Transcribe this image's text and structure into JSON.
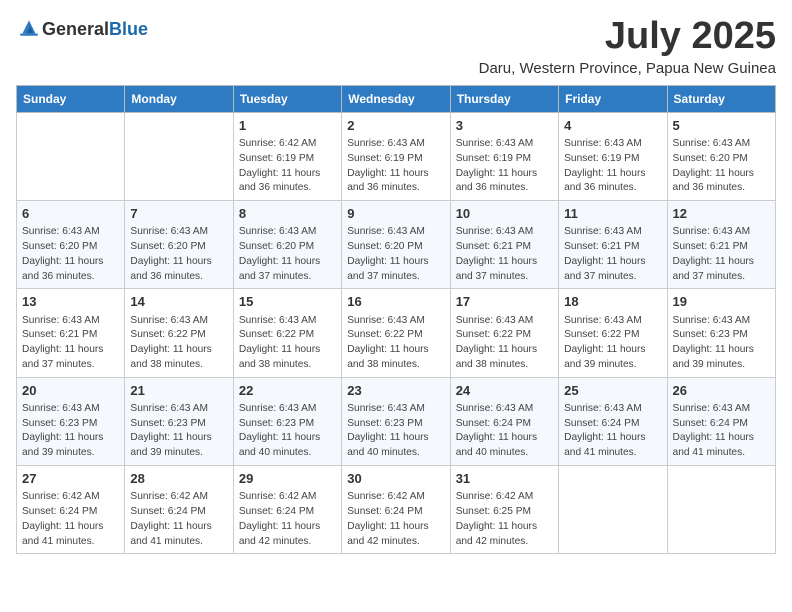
{
  "header": {
    "logo_general": "General",
    "logo_blue": "Blue",
    "month_title": "July 2025",
    "location": "Daru, Western Province, Papua New Guinea"
  },
  "weekdays": [
    "Sunday",
    "Monday",
    "Tuesday",
    "Wednesday",
    "Thursday",
    "Friday",
    "Saturday"
  ],
  "weeks": [
    [
      {
        "day": "",
        "info": ""
      },
      {
        "day": "",
        "info": ""
      },
      {
        "day": "1",
        "info": "Sunrise: 6:42 AM\nSunset: 6:19 PM\nDaylight: 11 hours and 36 minutes."
      },
      {
        "day": "2",
        "info": "Sunrise: 6:43 AM\nSunset: 6:19 PM\nDaylight: 11 hours and 36 minutes."
      },
      {
        "day": "3",
        "info": "Sunrise: 6:43 AM\nSunset: 6:19 PM\nDaylight: 11 hours and 36 minutes."
      },
      {
        "day": "4",
        "info": "Sunrise: 6:43 AM\nSunset: 6:19 PM\nDaylight: 11 hours and 36 minutes."
      },
      {
        "day": "5",
        "info": "Sunrise: 6:43 AM\nSunset: 6:20 PM\nDaylight: 11 hours and 36 minutes."
      }
    ],
    [
      {
        "day": "6",
        "info": "Sunrise: 6:43 AM\nSunset: 6:20 PM\nDaylight: 11 hours and 36 minutes."
      },
      {
        "day": "7",
        "info": "Sunrise: 6:43 AM\nSunset: 6:20 PM\nDaylight: 11 hours and 36 minutes."
      },
      {
        "day": "8",
        "info": "Sunrise: 6:43 AM\nSunset: 6:20 PM\nDaylight: 11 hours and 37 minutes."
      },
      {
        "day": "9",
        "info": "Sunrise: 6:43 AM\nSunset: 6:20 PM\nDaylight: 11 hours and 37 minutes."
      },
      {
        "day": "10",
        "info": "Sunrise: 6:43 AM\nSunset: 6:21 PM\nDaylight: 11 hours and 37 minutes."
      },
      {
        "day": "11",
        "info": "Sunrise: 6:43 AM\nSunset: 6:21 PM\nDaylight: 11 hours and 37 minutes."
      },
      {
        "day": "12",
        "info": "Sunrise: 6:43 AM\nSunset: 6:21 PM\nDaylight: 11 hours and 37 minutes."
      }
    ],
    [
      {
        "day": "13",
        "info": "Sunrise: 6:43 AM\nSunset: 6:21 PM\nDaylight: 11 hours and 37 minutes."
      },
      {
        "day": "14",
        "info": "Sunrise: 6:43 AM\nSunset: 6:22 PM\nDaylight: 11 hours and 38 minutes."
      },
      {
        "day": "15",
        "info": "Sunrise: 6:43 AM\nSunset: 6:22 PM\nDaylight: 11 hours and 38 minutes."
      },
      {
        "day": "16",
        "info": "Sunrise: 6:43 AM\nSunset: 6:22 PM\nDaylight: 11 hours and 38 minutes."
      },
      {
        "day": "17",
        "info": "Sunrise: 6:43 AM\nSunset: 6:22 PM\nDaylight: 11 hours and 38 minutes."
      },
      {
        "day": "18",
        "info": "Sunrise: 6:43 AM\nSunset: 6:22 PM\nDaylight: 11 hours and 39 minutes."
      },
      {
        "day": "19",
        "info": "Sunrise: 6:43 AM\nSunset: 6:23 PM\nDaylight: 11 hours and 39 minutes."
      }
    ],
    [
      {
        "day": "20",
        "info": "Sunrise: 6:43 AM\nSunset: 6:23 PM\nDaylight: 11 hours and 39 minutes."
      },
      {
        "day": "21",
        "info": "Sunrise: 6:43 AM\nSunset: 6:23 PM\nDaylight: 11 hours and 39 minutes."
      },
      {
        "day": "22",
        "info": "Sunrise: 6:43 AM\nSunset: 6:23 PM\nDaylight: 11 hours and 40 minutes."
      },
      {
        "day": "23",
        "info": "Sunrise: 6:43 AM\nSunset: 6:23 PM\nDaylight: 11 hours and 40 minutes."
      },
      {
        "day": "24",
        "info": "Sunrise: 6:43 AM\nSunset: 6:24 PM\nDaylight: 11 hours and 40 minutes."
      },
      {
        "day": "25",
        "info": "Sunrise: 6:43 AM\nSunset: 6:24 PM\nDaylight: 11 hours and 41 minutes."
      },
      {
        "day": "26",
        "info": "Sunrise: 6:43 AM\nSunset: 6:24 PM\nDaylight: 11 hours and 41 minutes."
      }
    ],
    [
      {
        "day": "27",
        "info": "Sunrise: 6:42 AM\nSunset: 6:24 PM\nDaylight: 11 hours and 41 minutes."
      },
      {
        "day": "28",
        "info": "Sunrise: 6:42 AM\nSunset: 6:24 PM\nDaylight: 11 hours and 41 minutes."
      },
      {
        "day": "29",
        "info": "Sunrise: 6:42 AM\nSunset: 6:24 PM\nDaylight: 11 hours and 42 minutes."
      },
      {
        "day": "30",
        "info": "Sunrise: 6:42 AM\nSunset: 6:24 PM\nDaylight: 11 hours and 42 minutes."
      },
      {
        "day": "31",
        "info": "Sunrise: 6:42 AM\nSunset: 6:25 PM\nDaylight: 11 hours and 42 minutes."
      },
      {
        "day": "",
        "info": ""
      },
      {
        "day": "",
        "info": ""
      }
    ]
  ]
}
